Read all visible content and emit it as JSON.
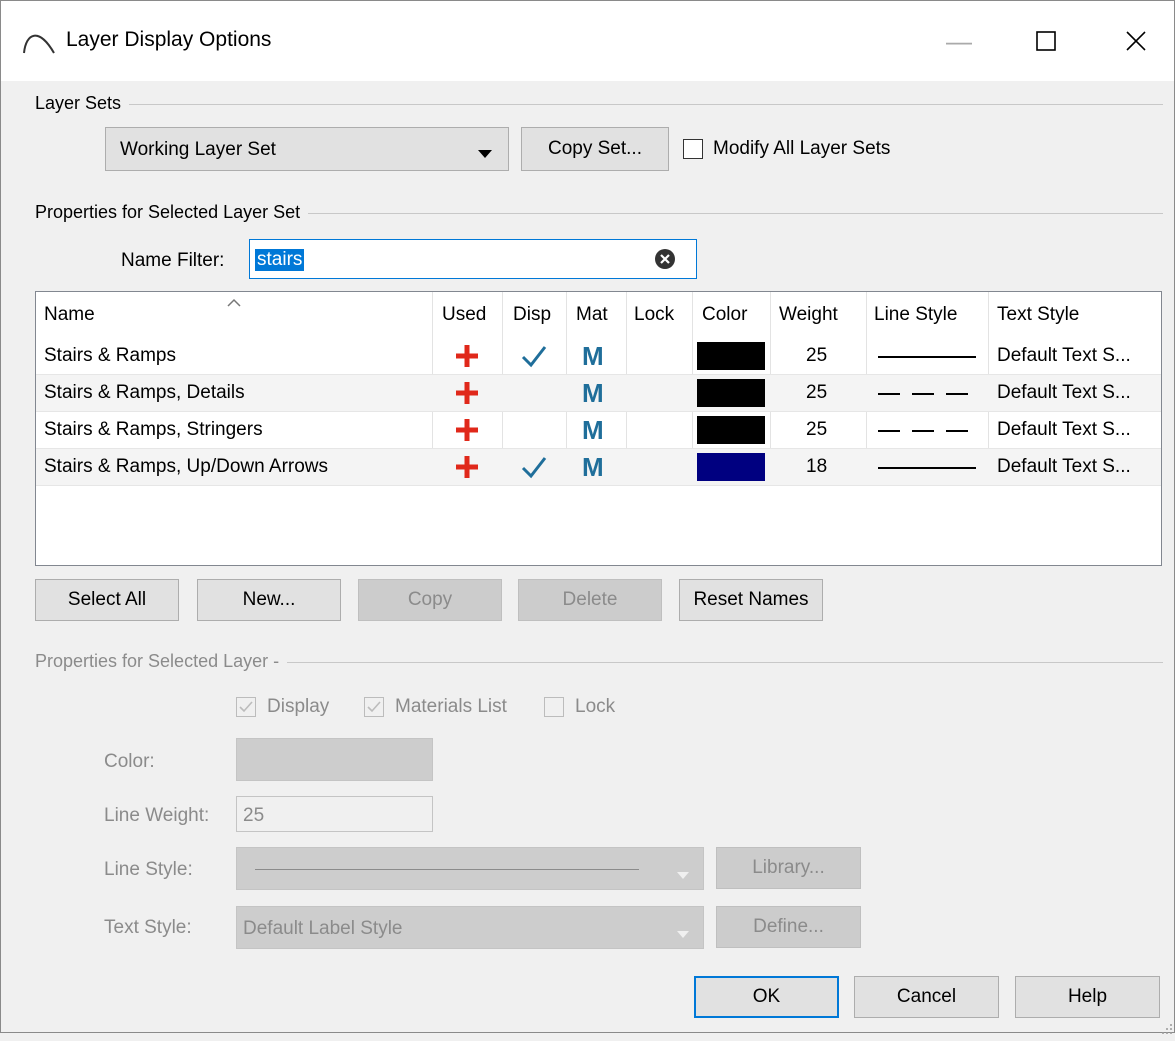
{
  "window": {
    "title": "Layer Display Options"
  },
  "layer_sets": {
    "group_label": "Layer Sets",
    "selected": "Working Layer Set",
    "copy_button": "Copy Set...",
    "modify_all_label": "Modify All Layer Sets",
    "modify_all_checked": false
  },
  "props_set": {
    "group_label": "Properties for Selected Layer Set",
    "name_filter_label": "Name Filter:",
    "name_filter_value": "stairs"
  },
  "table": {
    "columns": [
      "Name",
      "Used",
      "Disp",
      "Mat",
      "Lock",
      "Color",
      "Weight",
      "Line Style",
      "Text Style"
    ],
    "rows": [
      {
        "name": "Stairs & Ramps",
        "used": true,
        "disp": true,
        "mat": "M",
        "lock": false,
        "color": "#000000",
        "weight": "25",
        "line_style": "solid",
        "text_style": "Default Text S..."
      },
      {
        "name": "Stairs & Ramps, Details",
        "used": true,
        "disp": false,
        "mat": "M",
        "lock": false,
        "color": "#000000",
        "weight": "25",
        "line_style": "dashed",
        "text_style": "Default Text S..."
      },
      {
        "name": "Stairs & Ramps, Stringers",
        "used": true,
        "disp": false,
        "mat": "M",
        "lock": false,
        "color": "#000000",
        "weight": "25",
        "line_style": "dashed",
        "text_style": "Default Text S..."
      },
      {
        "name": "Stairs & Ramps, Up/Down Arrows",
        "used": true,
        "disp": true,
        "mat": "M",
        "lock": false,
        "color": "#000080",
        "weight": "18",
        "line_style": "solid",
        "text_style": "Default Text S..."
      }
    ]
  },
  "actions": {
    "select_all": "Select All",
    "new": "New...",
    "copy": "Copy",
    "delete": "Delete",
    "reset_names": "Reset Names"
  },
  "props_layer": {
    "group_label": "Properties for Selected Layer -",
    "display_label": "Display",
    "materials_label": "Materials List",
    "lock_label": "Lock",
    "color_label": "Color:",
    "line_weight_label": "Line Weight:",
    "line_weight_value": "25",
    "line_style_label": "Line Style:",
    "library_button": "Library...",
    "text_style_label": "Text Style:",
    "text_style_value": "Default Label Style",
    "define_button": "Define..."
  },
  "footer": {
    "ok": "OK",
    "cancel": "Cancel",
    "help": "Help"
  },
  "colors": {
    "accent": "#0078d7",
    "used_icon": "#e0281a",
    "mat_icon": "#1f6e9a"
  }
}
